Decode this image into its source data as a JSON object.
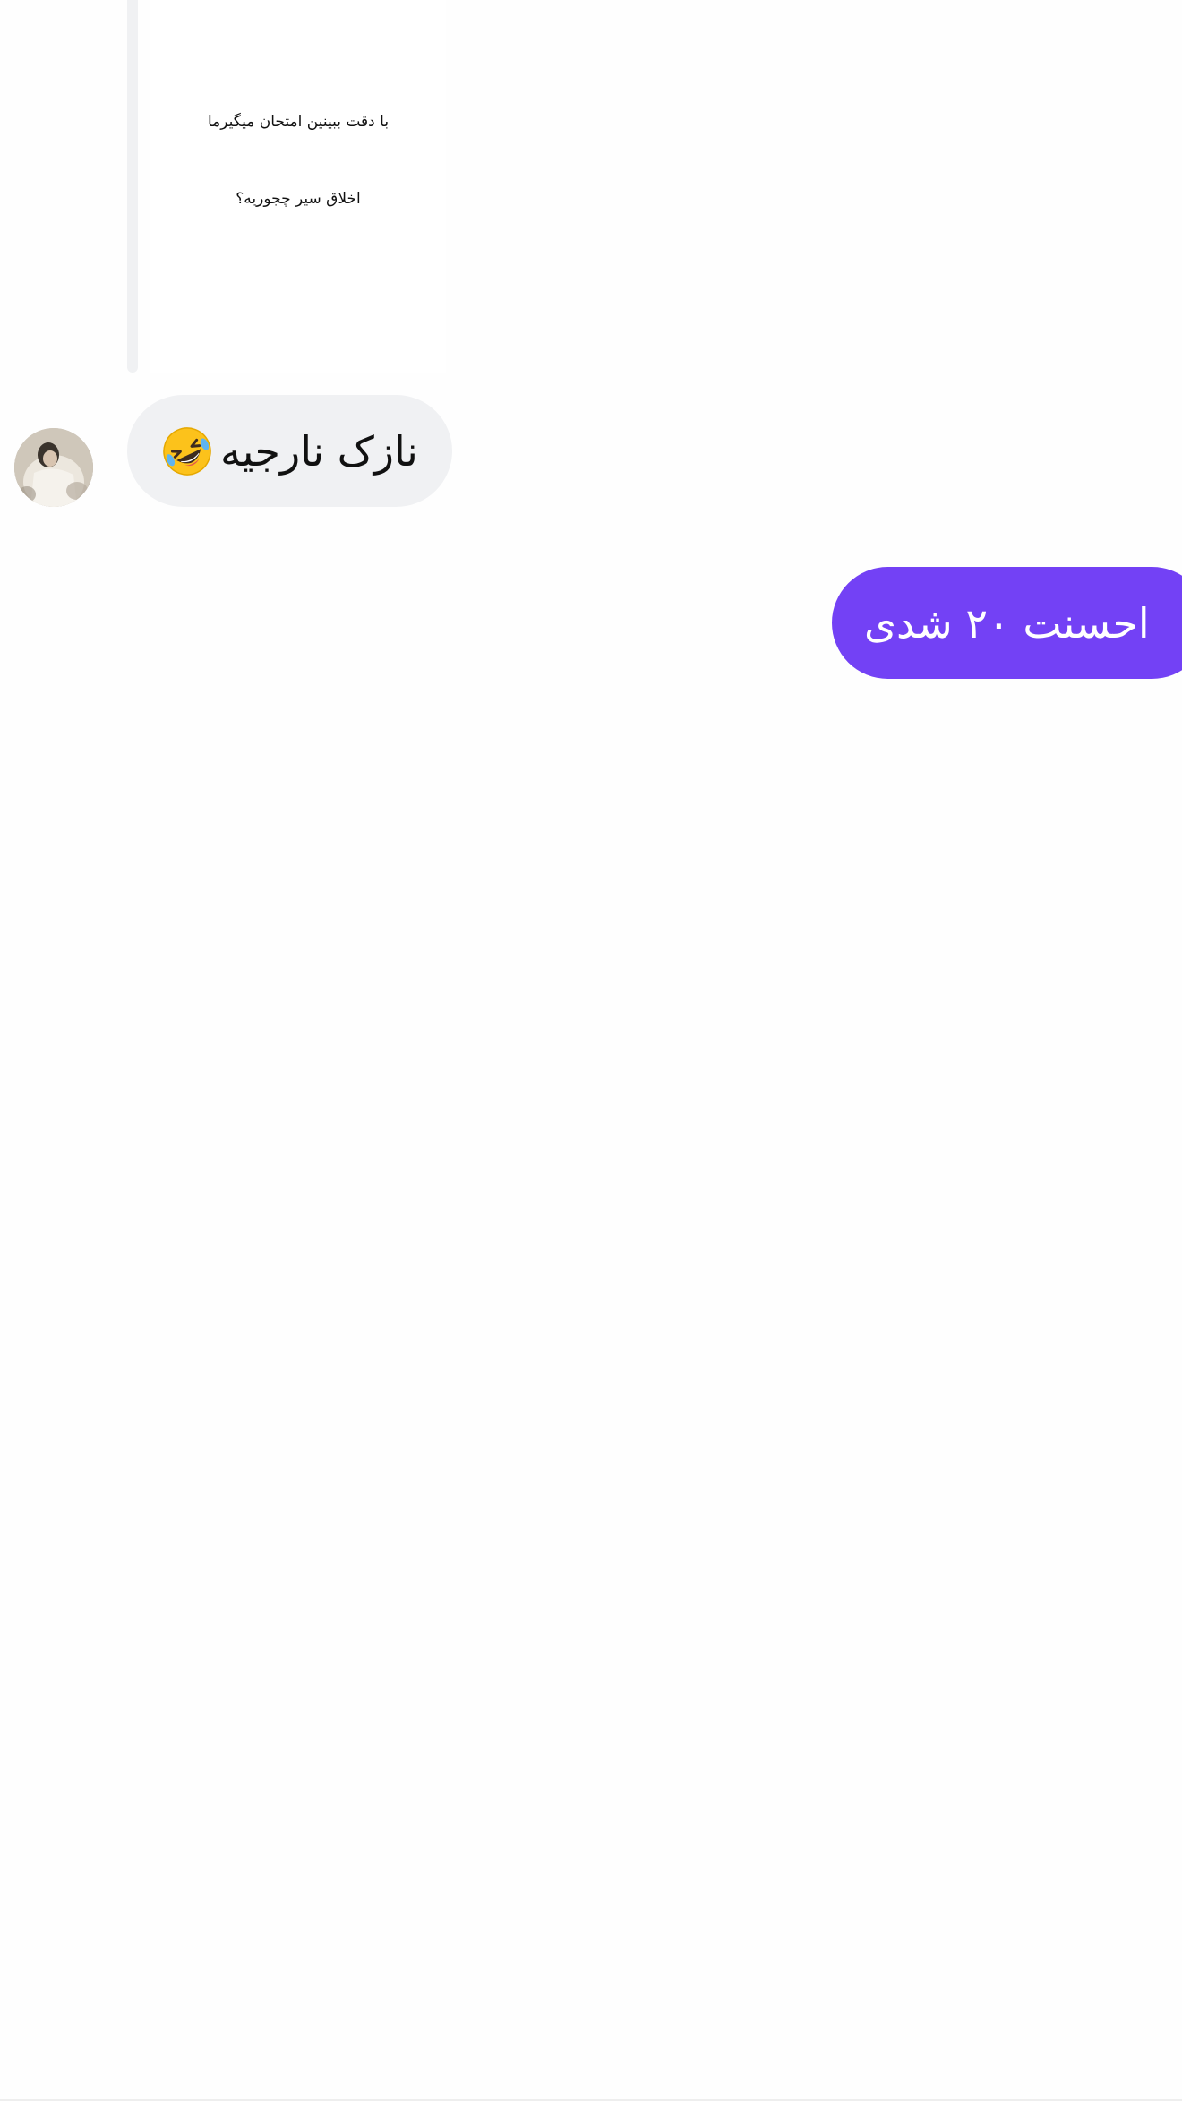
{
  "shared_post": {
    "line1": "با دقت ببینین امتحان میگیرما",
    "line2": "اخلاق سیر چجوریه؟"
  },
  "messages": [
    {
      "direction": "incoming",
      "text": "نازک نارجیه",
      "emoji": "rolling-on-floor-laughing-icon",
      "bubble_color": "#f0f1f3"
    },
    {
      "direction": "outgoing",
      "text": "احسنت ۲۰ شدی",
      "bubble_color": "#7341f5"
    }
  ],
  "colors": {
    "background": "#fefefe",
    "accent": "#7341f5",
    "incoming_bubble": "#f0f1f3"
  }
}
